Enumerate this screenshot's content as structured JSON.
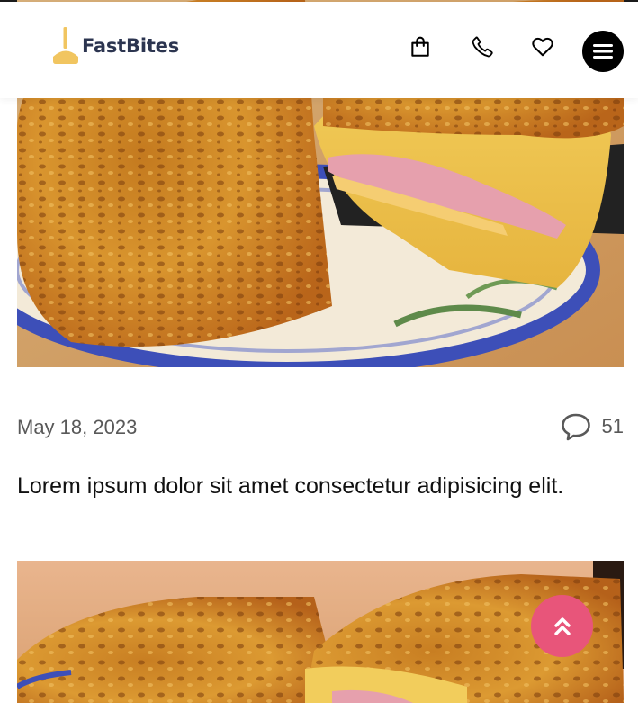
{
  "brand": {
    "name": "FastBites",
    "logo_icon": "fork-icon",
    "logo_color": "#f1c560",
    "name_color": "#2c3550"
  },
  "nav": {
    "icons": [
      "shopping-bag-icon",
      "phone-icon",
      "heart-icon",
      "hamburger-menu-icon"
    ]
  },
  "posts": [
    {
      "date": "May 18, 2023",
      "comments": "51",
      "excerpt": "Lorem ipsum dolor sit amet consectetur adipisicing elit.",
      "image": "tortilla-with-ham-and-cheese"
    },
    {
      "image": "tortilla-with-ham-and-cheese"
    }
  ],
  "scroll_top": {
    "icon": "double-chevron-up-icon",
    "color": "#e8557a"
  }
}
